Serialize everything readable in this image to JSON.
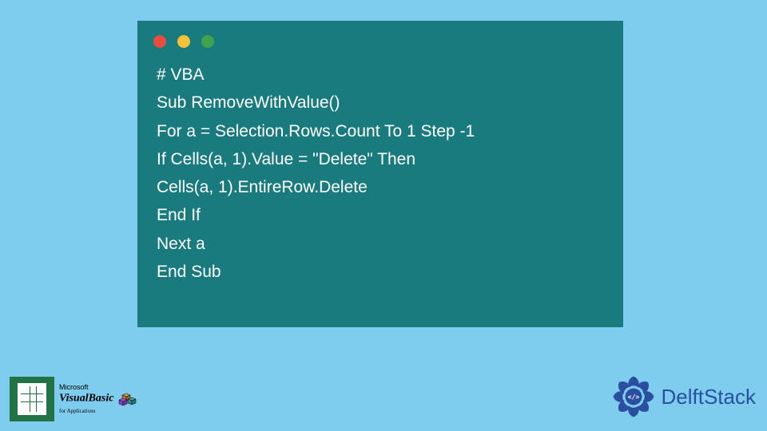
{
  "code": {
    "lines": [
      "# VBA",
      "Sub RemoveWithValue()",
      "For a = Selection.Rows.Count To 1 Step -1",
      "If Cells(a, 1).Value = \"Delete\" Then",
      "Cells(a, 1).EntireRow.Delete",
      "End If",
      "Next a",
      "End Sub"
    ]
  },
  "badges": {
    "vb": {
      "line1": "Microsoft",
      "line2": "VisualBasic",
      "line3": "for Applications"
    },
    "delft": {
      "label": "DelftStack"
    }
  }
}
